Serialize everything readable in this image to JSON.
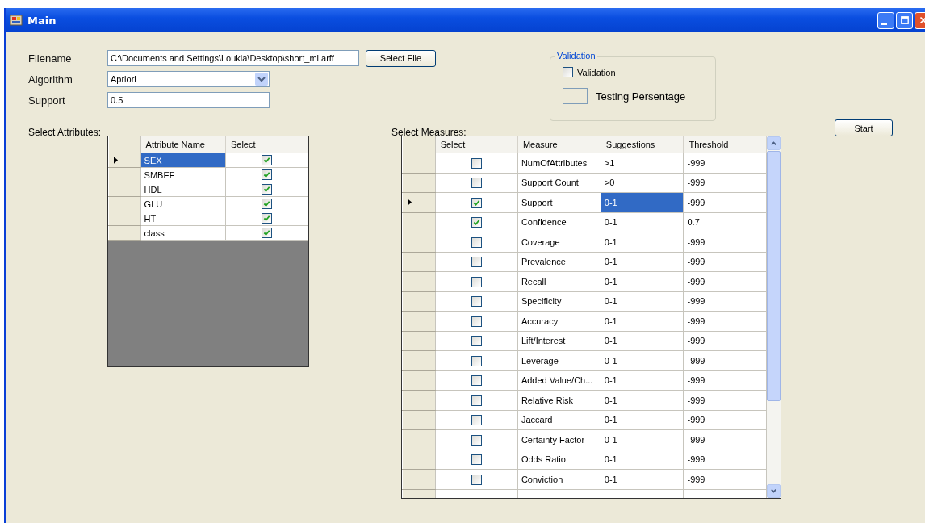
{
  "window": {
    "title": "Main"
  },
  "form": {
    "filename_label": "Filename",
    "filename_value": "C:\\Documents and Settings\\Loukia\\Desktop\\short_mi.arff",
    "select_file_button": "Select File",
    "algorithm_label": "Algorithm",
    "algorithm_value": "Apriori",
    "support_label": "Support",
    "support_value": "0.5"
  },
  "validation_group": {
    "title": "Validation",
    "checkbox_label": "Validation",
    "checked": false,
    "percentage_label": "Testing Persentage"
  },
  "start_button": "Start",
  "attributes": {
    "label": "Select Attributes:",
    "columns": [
      "Attribute Name",
      "Select"
    ],
    "rows": [
      {
        "name": "SEX",
        "checked": true,
        "selected": true
      },
      {
        "name": "SMBEF",
        "checked": true,
        "selected": false
      },
      {
        "name": "HDL",
        "checked": true,
        "selected": false
      },
      {
        "name": "GLU",
        "checked": true,
        "selected": false
      },
      {
        "name": "HT",
        "checked": true,
        "selected": false
      },
      {
        "name": "class",
        "checked": true,
        "selected": false
      }
    ]
  },
  "measures": {
    "label": "Select Measures:",
    "columns": [
      "Select",
      "Measure",
      "Suggestions",
      "Threshold"
    ],
    "rows": [
      {
        "checked": false,
        "measure": "NumOfAttributes",
        "suggestion": ">1",
        "threshold": "-999",
        "selected": false
      },
      {
        "checked": false,
        "measure": "Support Count",
        "suggestion": ">0",
        "threshold": "-999",
        "selected": false
      },
      {
        "checked": true,
        "measure": "Support",
        "suggestion": "0-1",
        "threshold": "-999",
        "selected": true
      },
      {
        "checked": true,
        "measure": "Confidence",
        "suggestion": "0-1",
        "threshold": "0.7",
        "selected": false
      },
      {
        "checked": false,
        "measure": "Coverage",
        "suggestion": "0-1",
        "threshold": "-999",
        "selected": false
      },
      {
        "checked": false,
        "measure": "Prevalence",
        "suggestion": "0-1",
        "threshold": "-999",
        "selected": false
      },
      {
        "checked": false,
        "measure": "Recall",
        "suggestion": "0-1",
        "threshold": "-999",
        "selected": false
      },
      {
        "checked": false,
        "measure": "Specificity",
        "suggestion": "0-1",
        "threshold": "-999",
        "selected": false
      },
      {
        "checked": false,
        "measure": "Accuracy",
        "suggestion": "0-1",
        "threshold": "-999",
        "selected": false
      },
      {
        "checked": false,
        "measure": "Lift/Interest",
        "suggestion": "0-1",
        "threshold": "-999",
        "selected": false
      },
      {
        "checked": false,
        "measure": "Leverage",
        "suggestion": "0-1",
        "threshold": "-999",
        "selected": false
      },
      {
        "checked": false,
        "measure": "Added Value/Ch...",
        "suggestion": "0-1",
        "threshold": "-999",
        "selected": false
      },
      {
        "checked": false,
        "measure": "Relative Risk",
        "suggestion": "0-1",
        "threshold": "-999",
        "selected": false
      },
      {
        "checked": false,
        "measure": "Jaccard",
        "suggestion": "0-1",
        "threshold": "-999",
        "selected": false
      },
      {
        "checked": false,
        "measure": "Certainty Factor",
        "suggestion": "0-1",
        "threshold": "-999",
        "selected": false
      },
      {
        "checked": false,
        "measure": "Odds Ratio",
        "suggestion": "0-1",
        "threshold": "-999",
        "selected": false
      },
      {
        "checked": false,
        "measure": "Conviction",
        "suggestion": "0-1",
        "threshold": "-999",
        "selected": false
      }
    ]
  }
}
